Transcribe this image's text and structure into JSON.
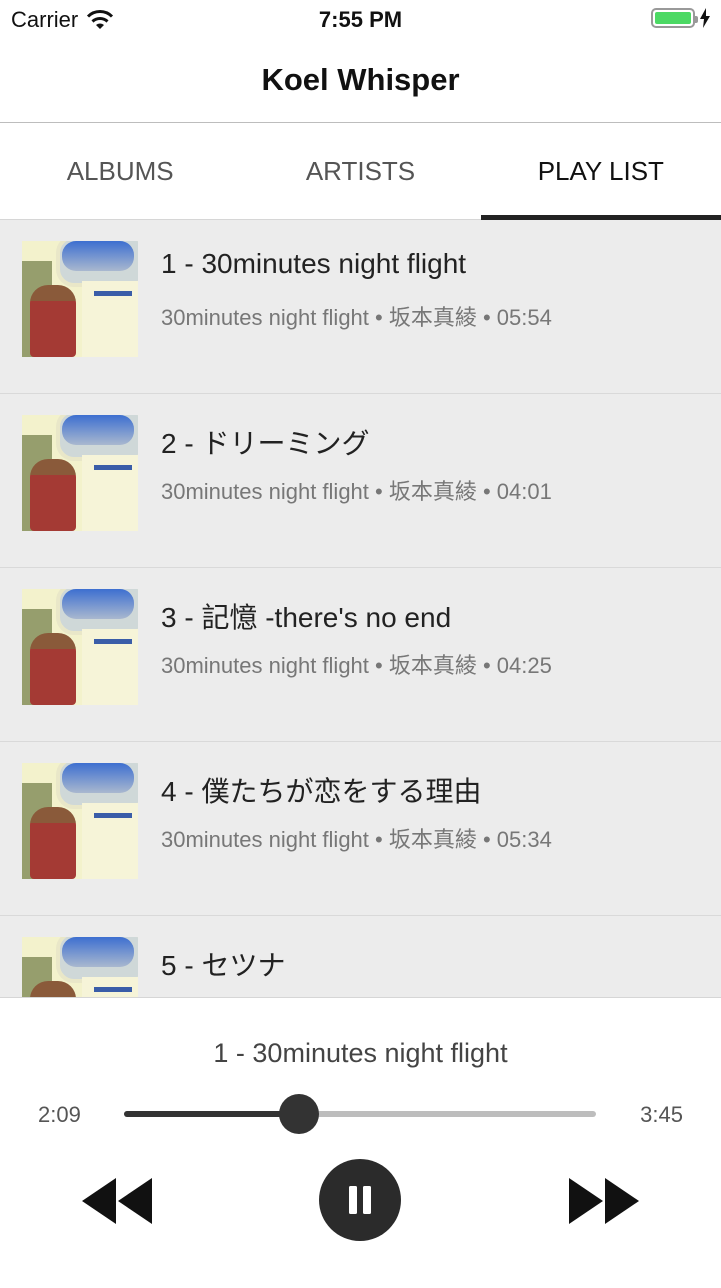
{
  "status_bar": {
    "carrier": "Carrier",
    "time": "7:55 PM",
    "battery_level": 1.0
  },
  "nav": {
    "title": "Koel Whisper"
  },
  "tabs": [
    {
      "label": "ALBUMS",
      "active": false
    },
    {
      "label": "ARTISTS",
      "active": false
    },
    {
      "label": "PLAY LIST",
      "active": true
    }
  ],
  "playlist": [
    {
      "title": "1 - 30minutes night flight",
      "meta": "30minutes night flight •  坂本真綾 • 05:54"
    },
    {
      "title": "2 - ドリーミング",
      "meta": "30minutes night flight •  坂本真綾 • 04:01"
    },
    {
      "title": "3 - 記憶 -there's no end",
      "meta": "30minutes night flight •  坂本真綾 • 04:25"
    },
    {
      "title": "4 - 僕たちが恋をする理由",
      "meta": "30minutes night flight •  坂本真綾 • 05:34"
    },
    {
      "title": "5 - セツナ",
      "meta": ""
    }
  ],
  "player": {
    "now_playing": "1 -  30minutes night flight",
    "elapsed": "2:09",
    "total": "3:45",
    "progress": 0.37,
    "accent": "#333333"
  },
  "icons": {
    "wifi": "wifi-icon",
    "battery": "battery-icon",
    "bolt": "charging-bolt-icon",
    "rewind": "rewind-icon",
    "pause": "pause-icon",
    "forward": "fast-forward-icon"
  }
}
